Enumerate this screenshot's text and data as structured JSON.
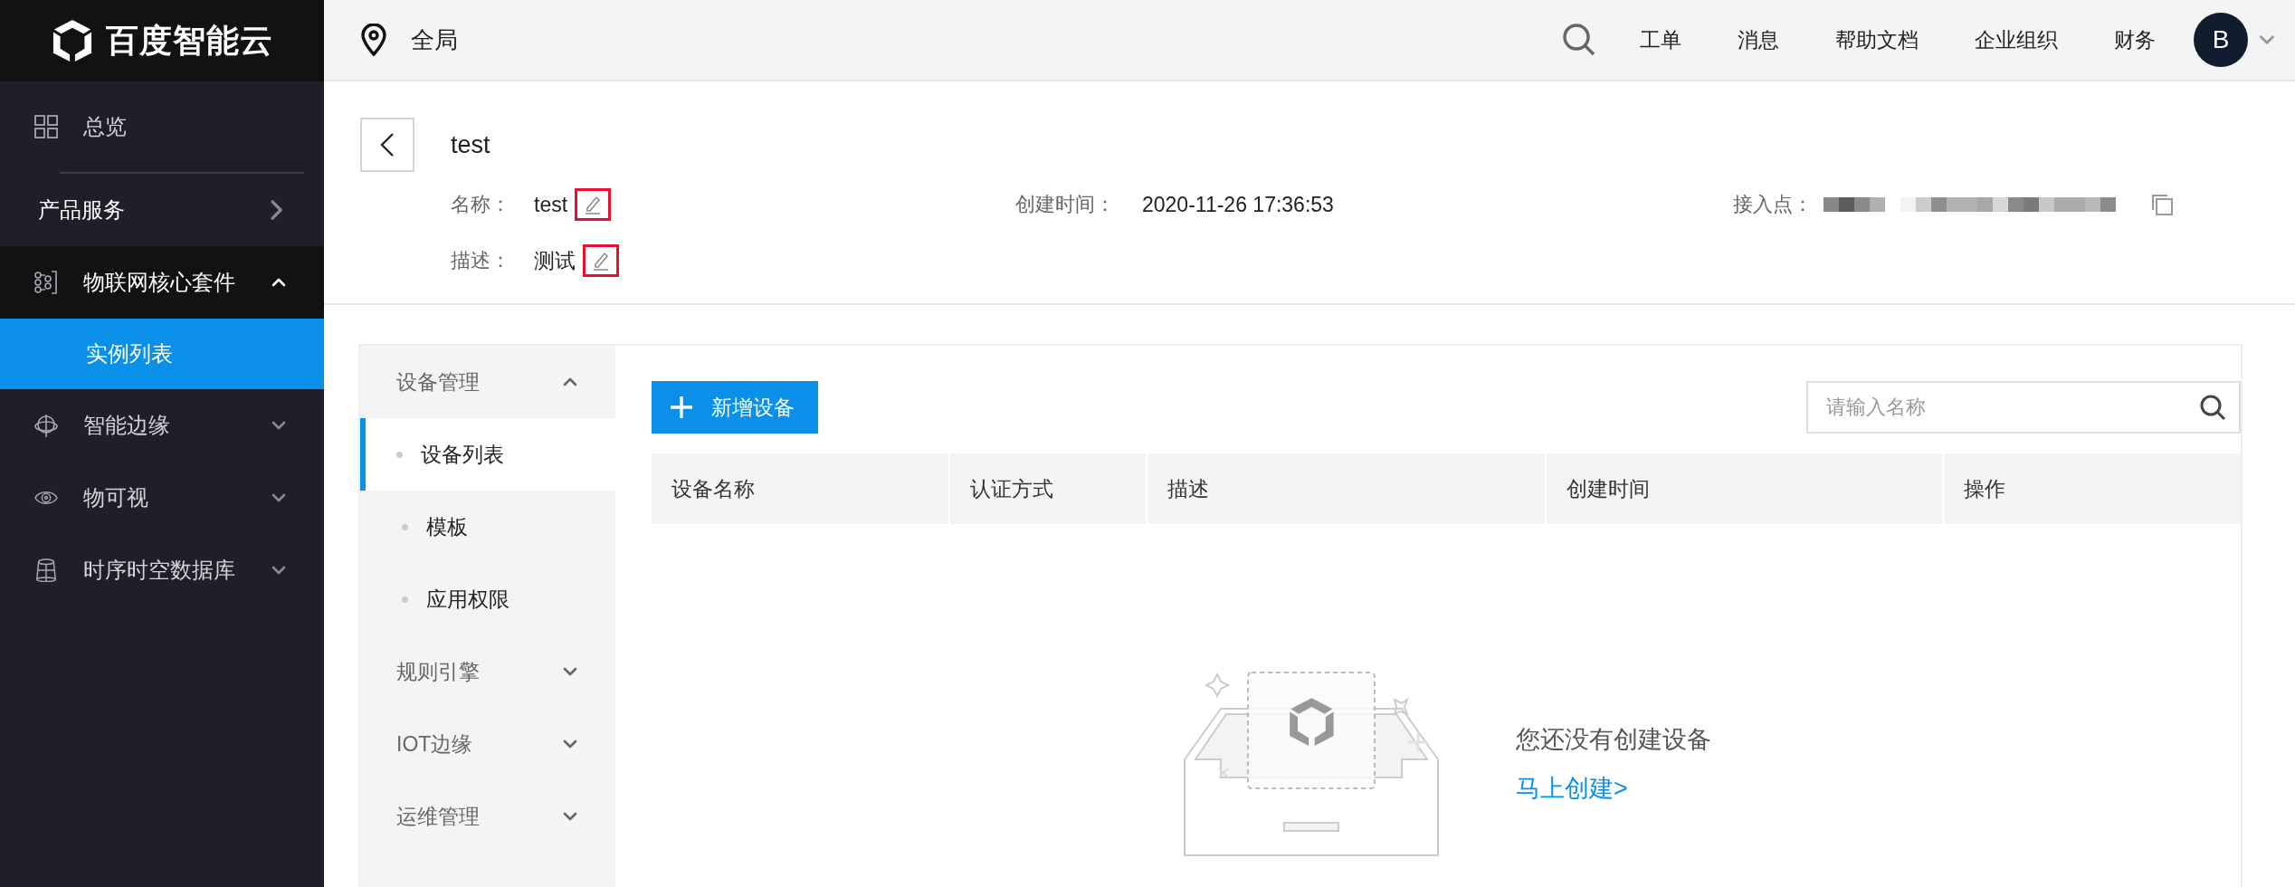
{
  "brand": {
    "name": "百度智能云"
  },
  "topbar": {
    "region": "全局",
    "links": [
      "工单",
      "消息",
      "帮助文档",
      "企业组织",
      "财务"
    ],
    "avatar": "B"
  },
  "sidebar": {
    "items": [
      {
        "label": "总览",
        "kind": "link"
      },
      {
        "label": "产品服务",
        "kind": "section"
      },
      {
        "label": "物联网核心套件",
        "kind": "group",
        "expanded": true,
        "children": [
          {
            "label": "实例列表",
            "selected": true
          }
        ]
      },
      {
        "label": "智能边缘",
        "kind": "group",
        "expanded": false
      },
      {
        "label": "物可视",
        "kind": "group",
        "expanded": false
      },
      {
        "label": "时序时空数据库",
        "kind": "group",
        "expanded": false
      }
    ]
  },
  "instance": {
    "title": "test",
    "name": {
      "label": "名称：",
      "value": "test",
      "highlighted": true
    },
    "created": {
      "label": "创建时间：",
      "value": "2020-11-26 17:36:53"
    },
    "endpoint": {
      "label": "接入点："
    },
    "description": {
      "label": "描述：",
      "value": "测试",
      "highlighted": true
    }
  },
  "subnav": {
    "groups": [
      {
        "label": "设备管理",
        "expanded": true,
        "children": [
          {
            "label": "设备列表",
            "selected": true
          },
          {
            "label": "模板",
            "selected": false
          },
          {
            "label": "应用权限",
            "selected": false
          }
        ]
      },
      {
        "label": "规则引擎",
        "expanded": false
      },
      {
        "label": "IOT边缘",
        "expanded": false
      },
      {
        "label": "运维管理",
        "expanded": false
      }
    ]
  },
  "toolbar": {
    "add_button": "新增设备",
    "search": {
      "placeholder": "请输入名称"
    }
  },
  "table": {
    "columns": [
      "设备名称",
      "认证方式",
      "描述",
      "创建时间",
      "操作"
    ]
  },
  "empty": {
    "message": "您还没有创建设备",
    "link": "马上创建>"
  }
}
